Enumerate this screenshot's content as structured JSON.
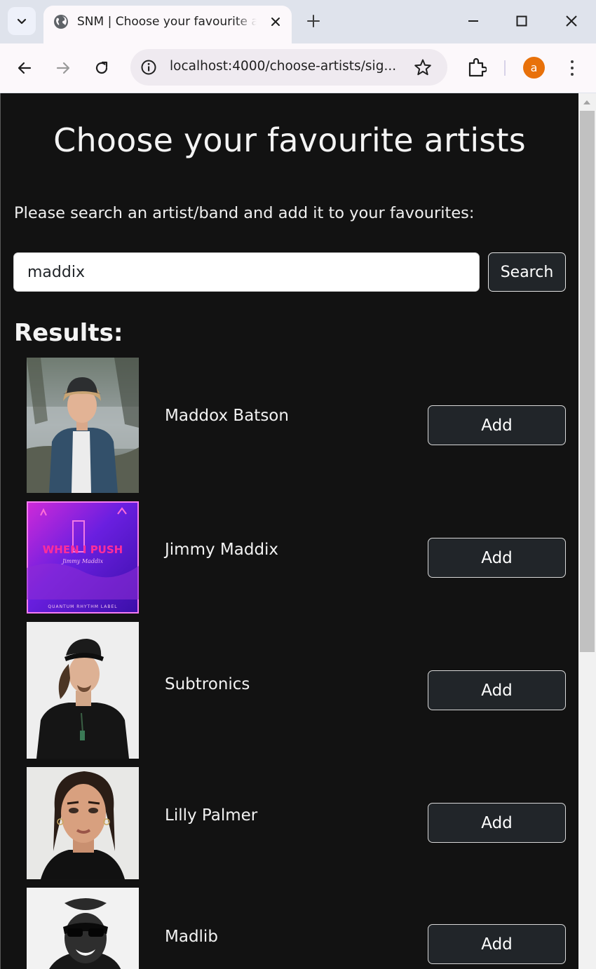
{
  "browser": {
    "tab_title": "SNM | Choose your favourite artists",
    "url": "localhost:4000/choose-artists/sig...",
    "profile_initial": "a",
    "icons": {
      "tab_search": "chevron-down-icon",
      "favicon": "globe-icon",
      "tab_close": "close-icon",
      "new_tab": "plus-icon",
      "minimize": "minimize-icon",
      "maximize": "maximize-icon",
      "close_window": "close-icon",
      "back": "back-arrow-icon",
      "forward": "forward-arrow-icon",
      "reload": "reload-icon",
      "site_info": "info-icon",
      "bookmark": "star-icon",
      "extensions": "puzzle-icon",
      "menu": "more-vert-icon"
    },
    "colors": {
      "tabstrip": "#dfe3ec",
      "toolbar": "#fcf8fb",
      "avatar": "#e8710a"
    }
  },
  "page": {
    "title": "Choose your favourite artists",
    "instructions": "Please search an artist/band and add it to your favourites:",
    "search": {
      "value": "maddix",
      "button_label": "Search"
    },
    "results_heading": "Results:",
    "results": [
      {
        "name": "Maddox Batson",
        "button_label": "Add",
        "image": "artist-photo"
      },
      {
        "name": "Jimmy Maddix",
        "button_label": "Add",
        "image": "album-cover",
        "cover_text": "WHEN I PUSH",
        "cover_subtext": "Jimmy Maddix",
        "cover_footer": "QUANTUM RHYTHM LABEL"
      },
      {
        "name": "Subtronics",
        "button_label": "Add",
        "image": "artist-photo"
      },
      {
        "name": "Lilly Palmer",
        "button_label": "Add",
        "image": "artist-photo"
      },
      {
        "name": "Madlib",
        "button_label": "Add",
        "image": "artist-photo"
      }
    ],
    "colors": {
      "background": "#121212",
      "button": "#212529",
      "text": "#ffffff"
    }
  }
}
